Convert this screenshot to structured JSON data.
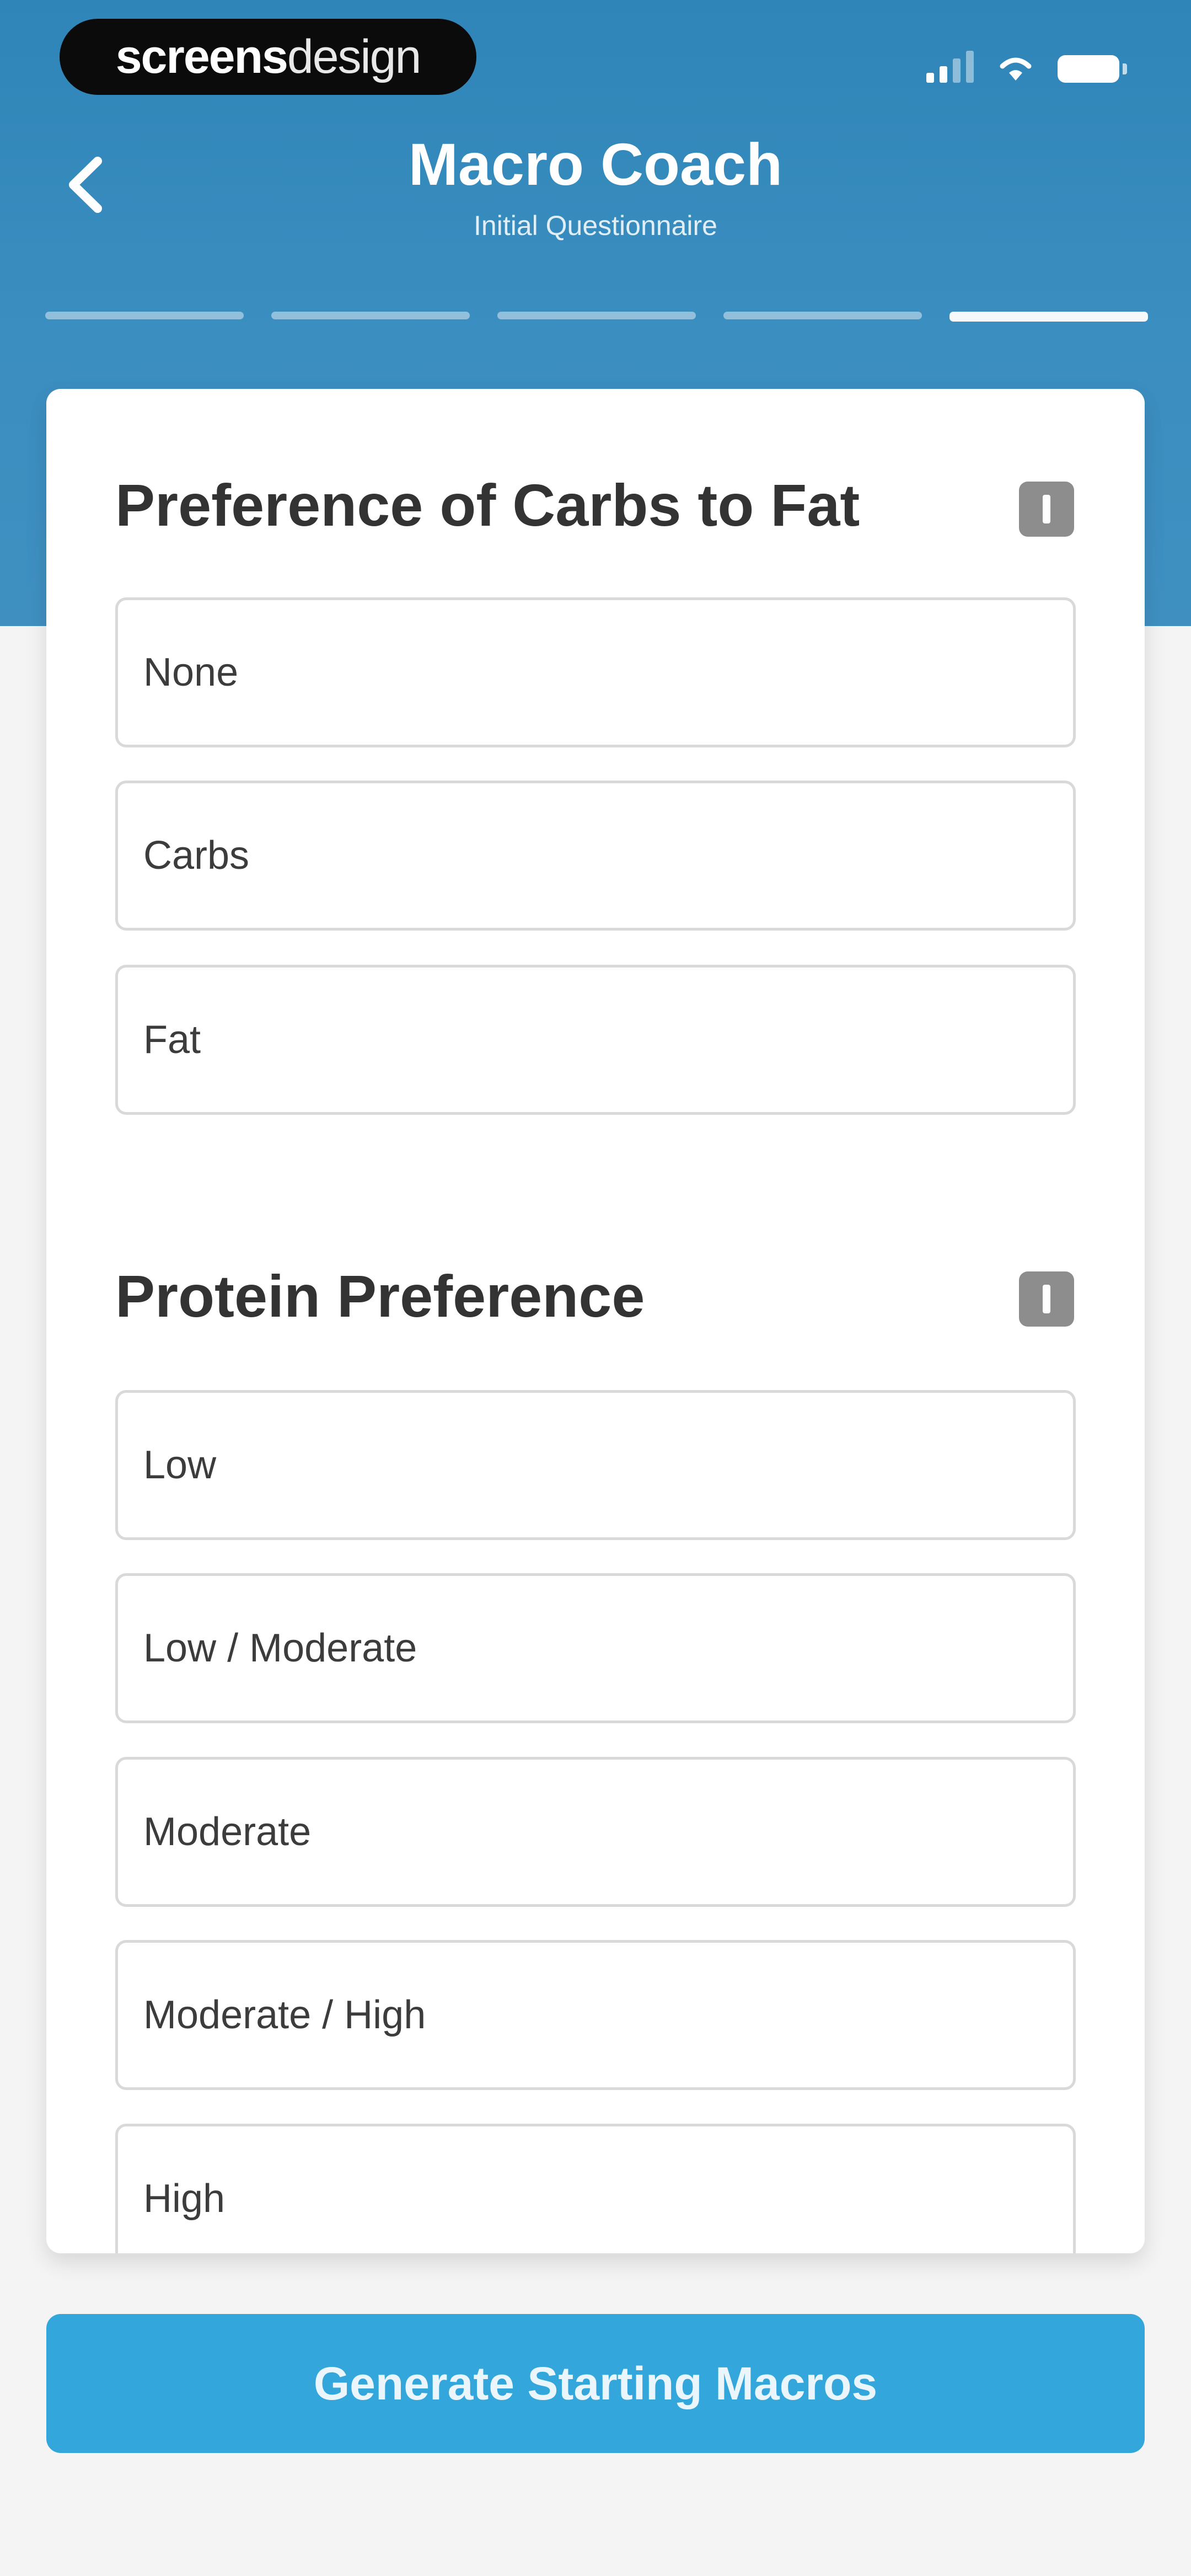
{
  "status_bar": {
    "brand_bold": "screens",
    "brand_light": "design"
  },
  "nav": {
    "title": "Macro Coach",
    "subtitle": "Initial Questionnaire",
    "back_icon": "chevron-left-icon"
  },
  "progress": {
    "total_steps": 5,
    "current_step": 5
  },
  "sections": [
    {
      "title": "Preference of Carbs to Fat",
      "info_icon": "info-icon",
      "options": [
        "None",
        "Carbs",
        "Fat"
      ]
    },
    {
      "title": "Protein Preference",
      "info_icon": "info-icon",
      "options": [
        "Low",
        "Low / Moderate",
        "Moderate",
        "Moderate / High",
        "High"
      ]
    }
  ],
  "cta": {
    "label": "Generate Starting Macros"
  },
  "colors": {
    "header": "#3b8ec0",
    "cta": "#33a6dc",
    "background": "#f4f4f5",
    "text_dark": "#333333"
  }
}
